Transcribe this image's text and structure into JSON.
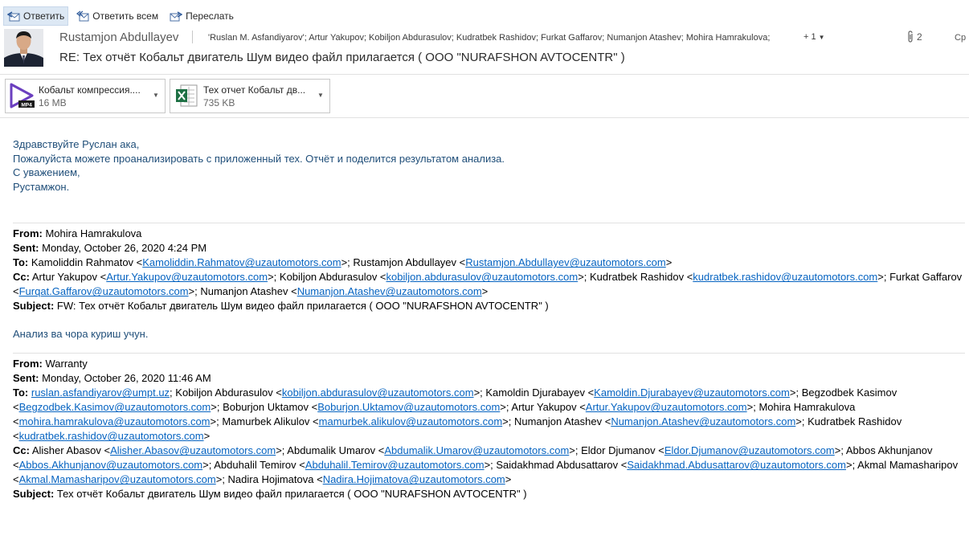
{
  "toolbar": {
    "reply_label": "Ответить",
    "reply_all_label": "Ответить всем",
    "forward_label": "Переслать"
  },
  "message": {
    "sender": "Rustamjon Abdullayev",
    "recipients": "'Ruslan M. Asfandiyarov'; Artur Yakupov; Kobiljon Abdurasulov; Kudratbek Rashidov; Furkat Gaffarov; Numanjon Atashev; Mohira Hamrakulova;",
    "more_recipients": "+ 1",
    "attachment_count": "2",
    "date_short": "Ср",
    "subject": "RE: Тех отчёт Кобальт двигатель Шум видео файл прилагается ( ООО \"NURAFSHON AVTOCENTR\" )"
  },
  "attachments": [
    {
      "name": "Кобальт компрессия....",
      "size": "16 MB",
      "icon": "video-file-icon"
    },
    {
      "name": "Тех отчет Кобальт дв...",
      "size": "735 KB",
      "icon": "excel-file-icon"
    }
  ],
  "body": {
    "lines": [
      "Здравствуйте Руслан ака,",
      "Пожалуйста можете проанализировать с приложенный тех. Отчёт и поделится результатом анализа.",
      "С уважением,",
      "Рустамжон."
    ]
  },
  "labels": {
    "from": "From:",
    "sent": "Sent:",
    "to": "To:",
    "cc": "Cc:",
    "subject": "Subject:"
  },
  "quoted1": {
    "from": "Mohira Hamrakulova",
    "sent": "Monday, October 26, 2020 4:24 PM",
    "to": [
      {
        "name": "Kamoliddin Rahmatov",
        "email": "Kamoliddin.Rahmatov@uzautomotors.com"
      },
      {
        "name": "Rustamjon Abdullayev",
        "email": "Rustamjon.Abdullayev@uzautomotors.com"
      }
    ],
    "cc": [
      {
        "name": "Artur Yakupov",
        "email": "Artur.Yakupov@uzautomotors.com"
      },
      {
        "name": "Kobiljon Abdurasulov",
        "email": "kobiljon.abdurasulov@uzautomotors.com"
      },
      {
        "name": "Kudratbek Rashidov",
        "email": "kudratbek.rashidov@uzautomotors.com"
      },
      {
        "name": "Furkat Gaffarov",
        "email": "Furqat.Gaffarov@uzautomotors.com"
      },
      {
        "name": "Numanjon Atashev",
        "email": "Numanjon.Atashev@uzautomotors.com"
      }
    ],
    "subject": "FW: Тех отчёт Кобальт двигатель Шум видео файл прилагается ( ООО \"NURAFSHON AVTOCENTR\" )",
    "note": "Анализ ва чора куриш учун."
  },
  "quoted2": {
    "from": "Warranty",
    "sent": "Monday, October 26, 2020 11:46 AM",
    "to": [
      {
        "name": "",
        "email": "ruslan.asfandiyarov@umpt.uz"
      },
      {
        "name": "Kobiljon Abdurasulov",
        "email": "kobiljon.abdurasulov@uzautomotors.com"
      },
      {
        "name": "Kamoldin Djurabayev",
        "email": "Kamoldin.Djurabayev@uzautomotors.com"
      },
      {
        "name": "Begzodbek Kasimov",
        "email": "Begzodbek.Kasimov@uzautomotors.com"
      },
      {
        "name": "Boburjon Uktamov",
        "email": "Boburjon.Uktamov@uzautomotors.com"
      },
      {
        "name": "Artur Yakupov",
        "email": "Artur.Yakupov@uzautomotors.com"
      },
      {
        "name": "Mohira Hamrakulova",
        "email": "mohira.hamrakulova@uzautomotors.com"
      },
      {
        "name": "Mamurbek Alikulov",
        "email": "mamurbek.alikulov@uzautomotors.com"
      },
      {
        "name": "Numanjon Atashev",
        "email": "Numanjon.Atashev@uzautomotors.com"
      },
      {
        "name": "Kudratbek Rashidov",
        "email": "kudratbek.rashidov@uzautomotors.com"
      }
    ],
    "cc": [
      {
        "name": "Alisher Abasov",
        "email": "Alisher.Abasov@uzautomotors.com"
      },
      {
        "name": "Abdumalik Umarov",
        "email": "Abdumalik.Umarov@uzautomotors.com"
      },
      {
        "name": "Eldor Djumanov",
        "email": "Eldor.Djumanov@uzautomotors.com"
      },
      {
        "name": "Abbos Akhunjanov",
        "email": "Abbos.Akhunjanov@uzautomotors.com"
      },
      {
        "name": "Abduhalil Temirov",
        "email": "Abduhalil.Temirov@uzautomotors.com"
      },
      {
        "name": "Saidakhmad Abdusattarov",
        "email": "Saidakhmad.Abdusattarov@uzautomotors.com"
      },
      {
        "name": "Akmal Mamasharipov",
        "email": "Akmal.Mamasharipov@uzautomotors.com"
      },
      {
        "name": "Nadira Hojimatova",
        "email": "Nadira.Hojimatova@uzautomotors.com"
      }
    ],
    "subject": "Тех отчёт Кобальт двигатель Шум видео файл прилагается ( ООО \"NURAFSHON AVTOCENTR\" )"
  }
}
